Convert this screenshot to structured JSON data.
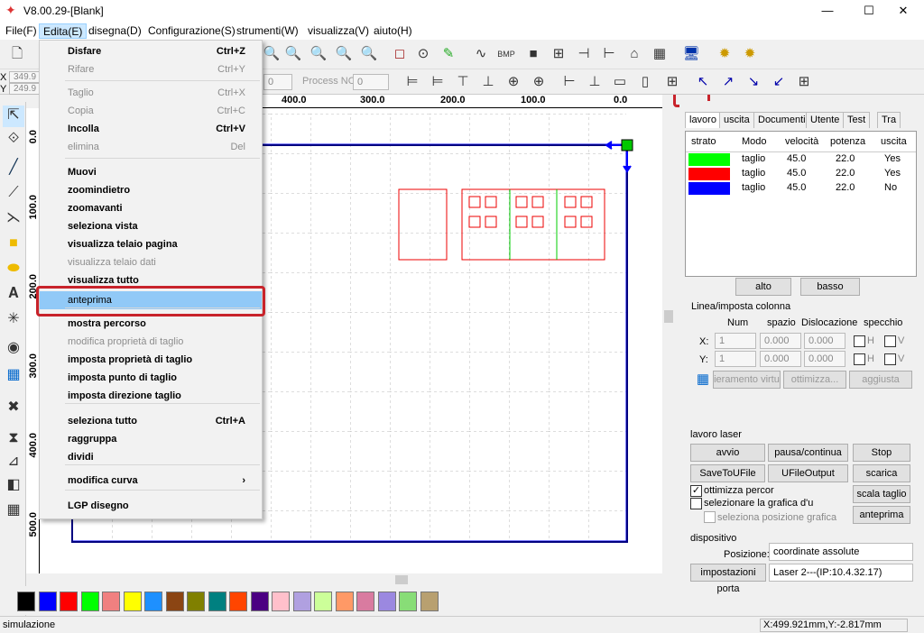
{
  "window": {
    "title": "V8.00.29-[Blank]",
    "minimize": "—",
    "maximize": "☐",
    "close": "✕"
  },
  "menubar": [
    "File(F)",
    "Edita(E)",
    "disegna(D)",
    "Configurazione(S)",
    "strumenti(W)",
    "visualizza(V)",
    "aiuto(H)"
  ],
  "toolbar2": {
    "process_label": "Process NO:",
    "process_value": "0",
    "offset_value": "0"
  },
  "ruler": {
    "h": [
      "400.0",
      "300.0",
      "200.0",
      "100.0",
      "0.0"
    ],
    "v": [
      "0.0",
      "100.0",
      "200.0",
      "300.0",
      "400.0",
      "500.0"
    ]
  },
  "coords": {
    "x_label": "X",
    "x_value": "349.9",
    "y_label": "Y",
    "y_value": "249.9"
  },
  "edit_menu": {
    "items": [
      {
        "label": "Disfare",
        "shortcut": "Ctrl+Z",
        "state": "bold"
      },
      {
        "label": "Rifare",
        "shortcut": "Ctrl+Y",
        "state": "dis"
      },
      {
        "label": "Taglio",
        "shortcut": "Ctrl+X",
        "state": "dis"
      },
      {
        "label": "Copia",
        "shortcut": "Ctrl+C",
        "state": "dis"
      },
      {
        "label": "Incolla",
        "shortcut": "Ctrl+V",
        "state": "bold"
      },
      {
        "label": "elimina",
        "shortcut": "Del",
        "state": "dis"
      },
      {
        "label": "Muovi",
        "shortcut": "",
        "state": "bold"
      },
      {
        "label": "zoomindietro",
        "shortcut": "",
        "state": "bold"
      },
      {
        "label": "zoomavanti",
        "shortcut": "",
        "state": "bold"
      },
      {
        "label": "seleziona vista",
        "shortcut": "",
        "state": "bold"
      },
      {
        "label": "visualizza telaio pagina",
        "shortcut": "",
        "state": "bold"
      },
      {
        "label": "visualizza telaio dati",
        "shortcut": "",
        "state": "dis"
      },
      {
        "label": "visualizza tutto",
        "shortcut": "",
        "state": "bold"
      },
      {
        "label": "anteprima",
        "shortcut": "",
        "state": "hl"
      },
      {
        "label": "mostra percorso",
        "shortcut": "",
        "state": "bold"
      },
      {
        "label": "modifica proprietà di taglio",
        "shortcut": "",
        "state": "dis"
      },
      {
        "label": "imposta proprietà di taglio",
        "shortcut": "",
        "state": "bold"
      },
      {
        "label": "imposta punto di taglio",
        "shortcut": "",
        "state": "bold"
      },
      {
        "label": "imposta direzione taglio",
        "shortcut": "",
        "state": "bold"
      },
      {
        "label": "seleziona tutto",
        "shortcut": "Ctrl+A",
        "state": "bold"
      },
      {
        "label": "raggruppa",
        "shortcut": "",
        "state": "bold"
      },
      {
        "label": "dividi",
        "shortcut": "",
        "state": "bold"
      },
      {
        "label": "modifica curva",
        "shortcut": "›",
        "state": "bold"
      },
      {
        "label": "LGP disegno",
        "shortcut": "",
        "state": "bold"
      }
    ]
  },
  "tabs": [
    "lavoro",
    "uscita",
    "Documenti",
    "Utente",
    "Test",
    "Tra"
  ],
  "layers": {
    "headers": [
      "strato",
      "Modo",
      "velocità",
      "potenza",
      "uscita"
    ],
    "rows": [
      {
        "color": "#00ff00",
        "mode": "taglio",
        "speed": "45.0",
        "power": "22.0",
        "out": "Yes"
      },
      {
        "color": "#ff0000",
        "mode": "taglio",
        "speed": "45.0",
        "power": "22.0",
        "out": "Yes"
      },
      {
        "color": "#0000ff",
        "mode": "taglio",
        "speed": "45.0",
        "power": "22.0",
        "out": "No"
      }
    ],
    "up": "alto",
    "down": "basso"
  },
  "array": {
    "title": "Linea/imposta colonna",
    "headers": [
      "Num",
      "spazio",
      "Dislocazione",
      "specchio"
    ],
    "x_label": "X:",
    "y_label": "Y:",
    "x": {
      "num": "1",
      "space": "0.000",
      "disp": "0.000"
    },
    "y": {
      "num": "1",
      "space": "0.000",
      "disp": "0.000"
    },
    "h": "H",
    "v": "V",
    "btn_virtual": "ieramento virtu",
    "btn_opt": "ottimizza...",
    "btn_adjust": "aggiusta"
  },
  "laser": {
    "title": "lavoro laser",
    "start": "avvio",
    "pause": "pausa/continua",
    "stop": "Stop",
    "save": "SaveToUFile",
    "ufile": "UFileOutput",
    "download": "scarica",
    "opt_path": "ottimizza percor",
    "sel_graphic": "selezionare la grafica d'u",
    "sel_pos": "seleziona posizione grafica",
    "scale": "scala taglio",
    "preview": "anteprima"
  },
  "device": {
    "title": "dispositivo",
    "pos_label": "Posizione:",
    "pos_value": "coordinate assolute",
    "port_btn": "impostazioni porta",
    "port_value": "Laser 2---(IP:10.4.32.17)"
  },
  "status": {
    "left": "simulazione",
    "right": "X:499.921mm,Y:-2.817mm"
  },
  "palette": [
    "#000000",
    "#0000ff",
    "#ff0000",
    "#00ff00",
    "#f08080",
    "#ffff00",
    "#1e90ff",
    "#8b4513",
    "#808000",
    "#008080",
    "#ff4500",
    "#4b0082",
    "#ffc0cb",
    "#b0a0e0",
    "#ccff99",
    "#ff9966",
    "#d97ba0",
    "#9b88e0",
    "#88dd77",
    "#b8a070"
  ]
}
